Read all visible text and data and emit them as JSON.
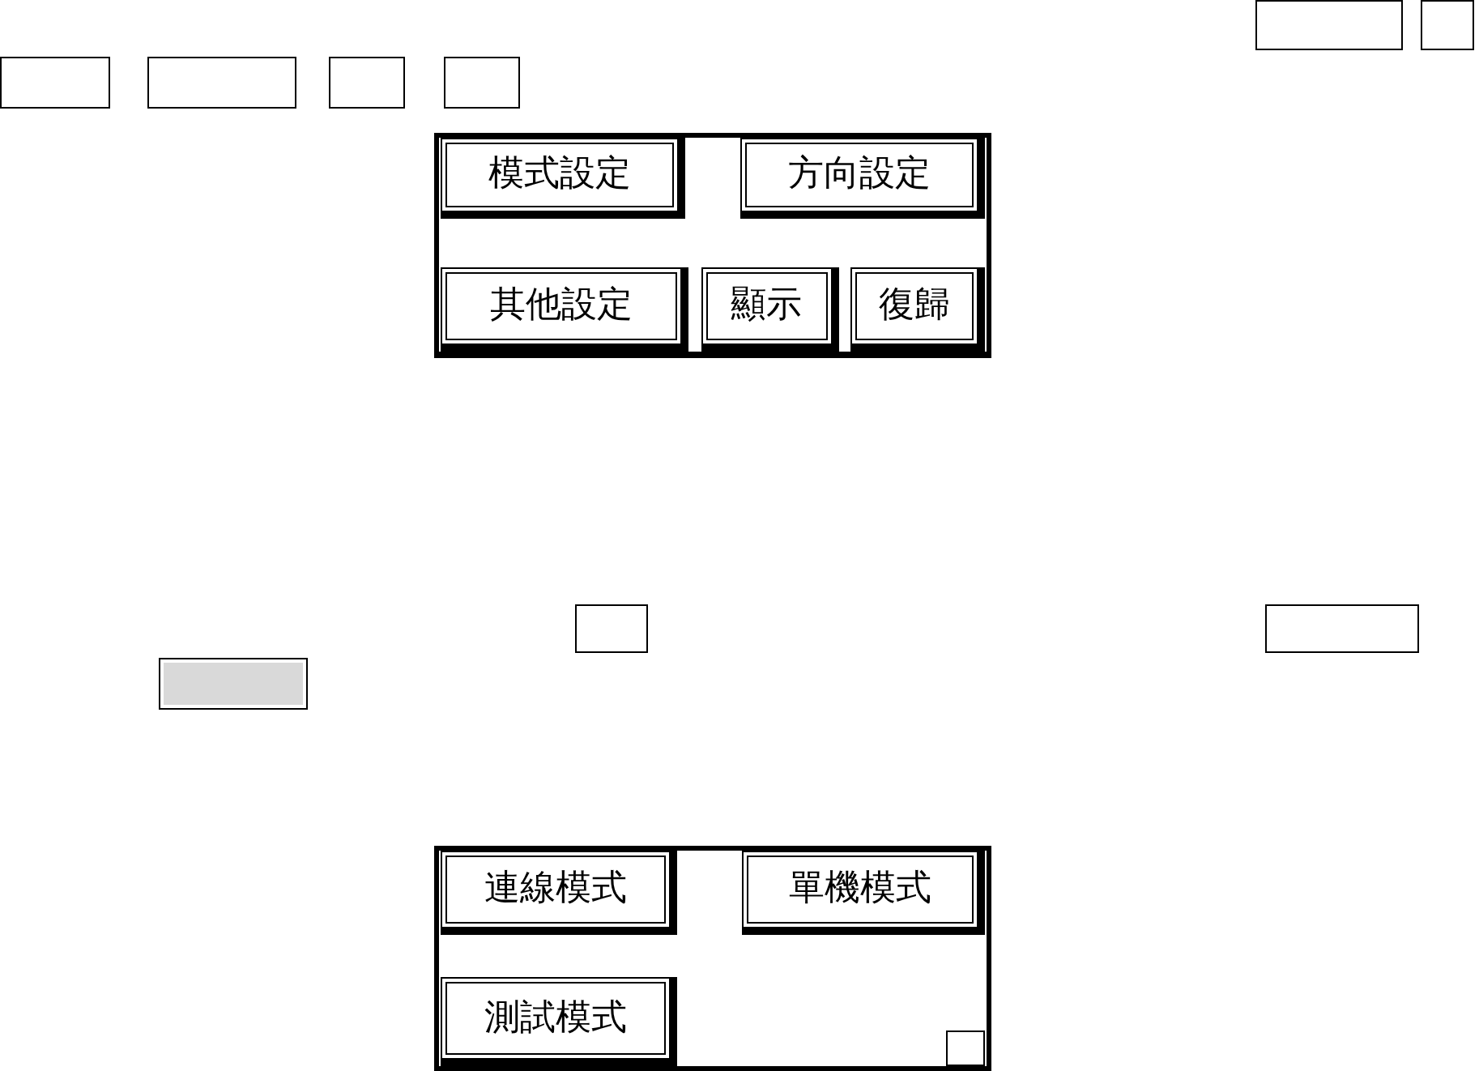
{
  "frame_lines_top": [
    {
      "frames": [
        {
          "kind": "outline"
        },
        {
          "kind": "outline"
        }
      ]
    },
    {
      "frames": [
        {
          "kind": "outline"
        },
        {
          "kind": "outline"
        },
        {
          "kind": "outline"
        },
        {
          "kind": "outline"
        }
      ]
    }
  ],
  "settings_panel": {
    "rows": [
      {
        "buttons": [
          {
            "label": "模式設定"
          },
          {
            "label": "方向設定"
          }
        ]
      },
      {
        "buttons": [
          {
            "label": "其他設定"
          },
          {
            "label": "顯示"
          },
          {
            "label": "復歸"
          }
        ]
      }
    ]
  },
  "frame_lines_middle": [
    {
      "frames": [
        {
          "kind": "outline"
        },
        {
          "kind": "outline"
        }
      ]
    },
    {
      "frames": [
        {
          "kind": "shaded"
        }
      ]
    }
  ],
  "mode_panel": {
    "rows": [
      {
        "buttons": [
          {
            "label": "連線模式"
          },
          {
            "label": "單機模式"
          }
        ]
      },
      {
        "buttons": [
          {
            "label": "測試模式"
          }
        ]
      }
    ]
  }
}
